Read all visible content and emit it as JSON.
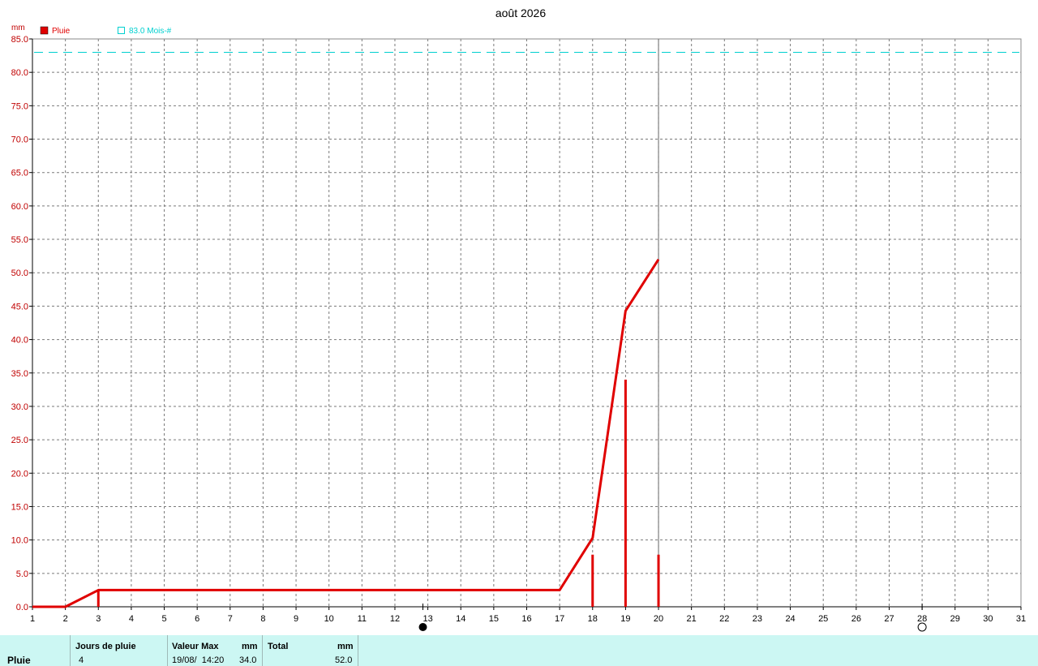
{
  "chart_data": {
    "type": "line",
    "title": "août 2026",
    "y_unit": "mm",
    "ylim": [
      0,
      85
    ],
    "y_ticks": [
      "0.0",
      "5.0",
      "10.0",
      "15.0",
      "20.0",
      "25.0",
      "30.0",
      "35.0",
      "40.0",
      "45.0",
      "50.0",
      "55.0",
      "60.0",
      "65.0",
      "70.0",
      "75.0",
      "80.0",
      "85.0"
    ],
    "xlim": [
      1,
      31
    ],
    "x_ticks": [
      "1",
      "2",
      "3",
      "4",
      "5",
      "6",
      "7",
      "8",
      "9",
      "10",
      "11",
      "12",
      "13",
      "14",
      "15",
      "16",
      "17",
      "18",
      "19",
      "20",
      "21",
      "22",
      "23",
      "24",
      "25",
      "26",
      "27",
      "28",
      "29",
      "30",
      "31"
    ],
    "grid": true,
    "legend": [
      {
        "label": "Pluie",
        "color": "#e00000",
        "marker": "filled-square"
      },
      {
        "label": "83.0 Mois-#",
        "color": "#00d0d0",
        "marker": "open-square"
      }
    ],
    "series": [
      {
        "name": "Pluie",
        "kind": "cumulative-line",
        "color": "#e00000",
        "points": [
          [
            1,
            0
          ],
          [
            2,
            0
          ],
          [
            2.2,
            0.5
          ],
          [
            3,
            2.5
          ],
          [
            17,
            2.5
          ],
          [
            18,
            10.3
          ],
          [
            19,
            44.3
          ],
          [
            20,
            52.0
          ]
        ]
      },
      {
        "name": "Pluie",
        "kind": "daily-bars",
        "color": "#e00000",
        "points": [
          [
            3,
            2.5
          ],
          [
            18,
            7.8
          ],
          [
            19,
            34.0
          ],
          [
            20,
            7.8
          ]
        ]
      },
      {
        "name": "83.0 Mois-#",
        "kind": "reference-line",
        "color": "#00d0d0",
        "value": 83.0
      }
    ],
    "current_day_line": 20,
    "moon_markers": [
      {
        "day": 12.85,
        "phase": "new-moon"
      },
      {
        "day": 28.0,
        "phase": "full-moon"
      }
    ]
  },
  "footer": {
    "row_label": "Pluie",
    "days_header": "Jours de pluie",
    "days_value": "4",
    "max_header": "Valeur Max",
    "max_unit": "mm",
    "max_date": "19/08/  14:20",
    "max_value": "34.0",
    "total_header": "Total",
    "total_unit": "mm",
    "total_value": "52.0"
  }
}
